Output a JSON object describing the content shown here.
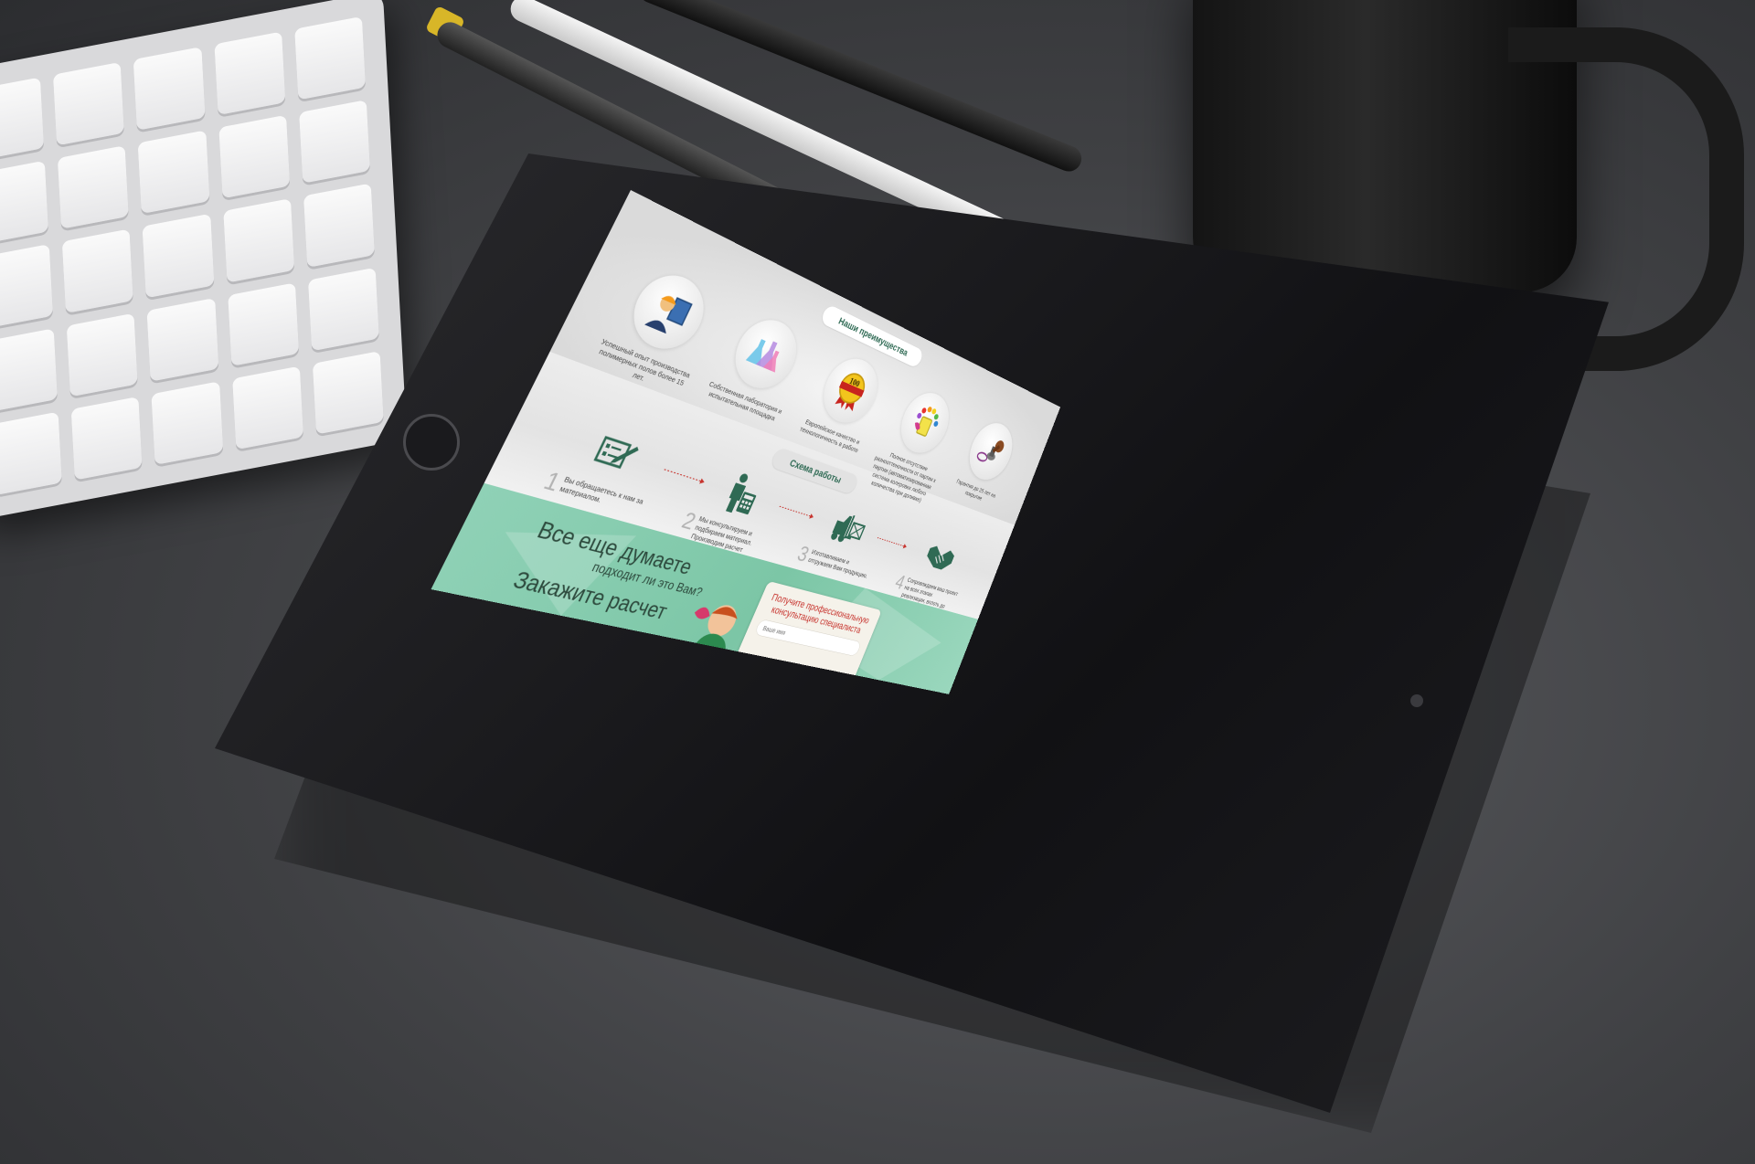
{
  "advantages_section": {
    "title": "Наши преимущества",
    "items": [
      {
        "icon": "worker-blueprint-icon",
        "text": "Успешный опыт производства полимерных полов более 15 лет."
      },
      {
        "icon": "laboratory-flasks-icon",
        "text": "Собственная лаборатория и испытательная площадка"
      },
      {
        "icon": "quality-badge-icon",
        "badge": "100",
        "text": "Европейское качество и технологичность в работе"
      },
      {
        "icon": "paint-palette-icon",
        "text": "Полное отсутствие разнооттеночности от партии к партии (автоматизированная система колеровки любого количества при доливке)"
      },
      {
        "icon": "guarantee-stamp-icon",
        "text": "Гарантия до 25 лет на покрытие"
      }
    ]
  },
  "workflow_section": {
    "title": "Схема работы",
    "steps": [
      {
        "num": "1",
        "icon": "application-form-icon",
        "text": "Вы обращаетесь к нам за материалом."
      },
      {
        "num": "2",
        "icon": "consultant-calculator-icon",
        "text": "Мы консультируем и подбираем материал. Производим расчет нужного объема."
      },
      {
        "num": "3",
        "icon": "forklift-icon",
        "text": "Изготавливаем и отгружаем Вам продукцию."
      },
      {
        "num": "4",
        "icon": "handshake-icon",
        "text": "Сопровождаем ваш проект на всех этапах реализации, вплоть до сдачи."
      }
    ]
  },
  "cta_section": {
    "headline": "Все еще думаете",
    "subheadline": "подходит ли это Вам?",
    "order_headline": "Закажите расчет",
    "form": {
      "title": "Получите профессиональную консультацию специалиста",
      "name_placeholder": "Ваше имя"
    }
  },
  "colors": {
    "brand_green": "#2f6a54",
    "cta_green": "#7cc6a6",
    "form_title_red": "#c7332d"
  }
}
